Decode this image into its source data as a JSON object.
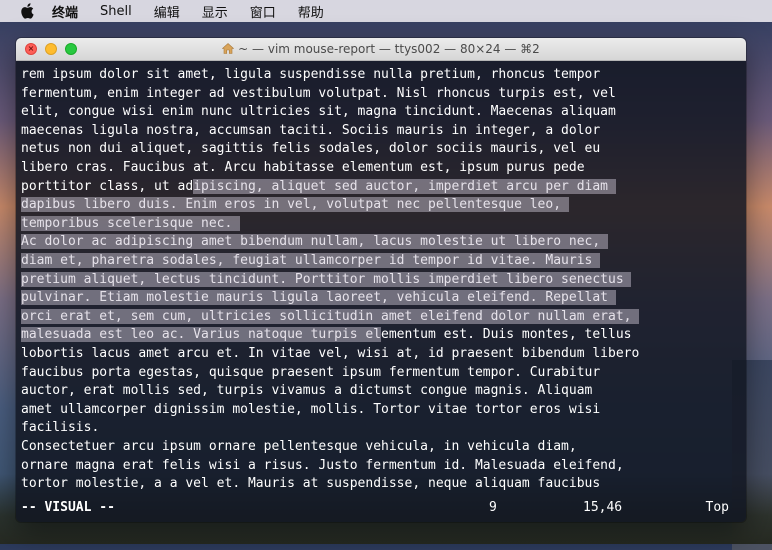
{
  "menubar": {
    "app_icon": "apple-icon",
    "items": [
      "终端",
      "Shell",
      "编辑",
      "显示",
      "窗口",
      "帮助"
    ]
  },
  "window": {
    "title": "~ — vim mouse-report — ttys002 — 80×24 — ⌘2",
    "title_icon": "home-icon"
  },
  "terminal": {
    "lines": [
      [
        {
          "t": "rem ipsum dolor sit amet, ligula suspendisse nulla pretium, rhoncus tempor",
          "s": false
        }
      ],
      [
        {
          "t": "fermentum, enim integer ad vestibulum volutpat. Nisl rhoncus turpis est, vel",
          "s": false
        }
      ],
      [
        {
          "t": "elit, congue wisi enim nunc ultricies sit, magna tincidunt. Maecenas aliquam",
          "s": false
        }
      ],
      [
        {
          "t": "maecenas ligula nostra, accumsan taciti. Sociis mauris in integer, a dolor",
          "s": false
        }
      ],
      [
        {
          "t": "netus non dui aliquet, sagittis felis sodales, dolor sociis mauris, vel eu",
          "s": false
        }
      ],
      [
        {
          "t": "libero cras. Faucibus at. Arcu habitasse elementum est, ipsum purus pede",
          "s": false
        }
      ],
      [
        {
          "t": "porttitor class, ut ad",
          "s": false
        },
        {
          "t": "ipiscing, aliquet sed auctor, imperdiet arcu per diam ",
          "s": true
        }
      ],
      [
        {
          "t": "dapibus libero duis. Enim eros in vel, volutpat nec pellentesque leo, ",
          "s": true
        }
      ],
      [
        {
          "t": "temporibus scelerisque nec. ",
          "s": true
        }
      ],
      [
        {
          "t": "Ac dolor ac adipiscing amet bibendum nullam, lacus molestie ut libero nec, ",
          "s": true
        }
      ],
      [
        {
          "t": "diam et, pharetra sodales, feugiat ullamcorper id tempor id vitae. Mauris ",
          "s": true
        }
      ],
      [
        {
          "t": "pretium aliquet, lectus tincidunt. Porttitor mollis imperdiet libero senectus ",
          "s": true
        }
      ],
      [
        {
          "t": "pulvinar. Etiam molestie mauris ligula laoreet, vehicula eleifend. Repellat ",
          "s": true
        }
      ],
      [
        {
          "t": "orci erat et, sem cum, ultricies sollicitudin amet eleifend dolor nullam erat, ",
          "s": true
        }
      ],
      [
        {
          "t": "malesuada est leo ac. Varius natoque turpis el",
          "s": true
        },
        {
          "t": "ementum est. Duis montes, tellus",
          "s": false
        }
      ],
      [
        {
          "t": "lobortis lacus amet arcu et. In vitae vel, wisi at, id praesent bibendum libero",
          "s": false
        }
      ],
      [
        {
          "t": "faucibus porta egestas, quisque praesent ipsum fermentum tempor. Curabitur",
          "s": false
        }
      ],
      [
        {
          "t": "auctor, erat mollis sed, turpis vivamus a dictumst congue magnis. Aliquam",
          "s": false
        }
      ],
      [
        {
          "t": "amet ullamcorper dignissim molestie, mollis. Tortor vitae tortor eros wisi",
          "s": false
        }
      ],
      [
        {
          "t": "facilisis.",
          "s": false
        }
      ],
      [
        {
          "t": "Consectetuer arcu ipsum ornare pellentesque vehicula, in vehicula diam,",
          "s": false
        }
      ],
      [
        {
          "t": "ornare magna erat felis wisi a risus. Justo fermentum id. Malesuada eleifend,",
          "s": false
        }
      ],
      [
        {
          "t": "tortor molestie, a a vel et. Mauris at suspendisse, neque aliquam faucibus",
          "s": false
        }
      ]
    ],
    "status": {
      "mode": "-- VISUAL --",
      "count": "9",
      "position": "15,46",
      "scroll": "Top"
    }
  }
}
